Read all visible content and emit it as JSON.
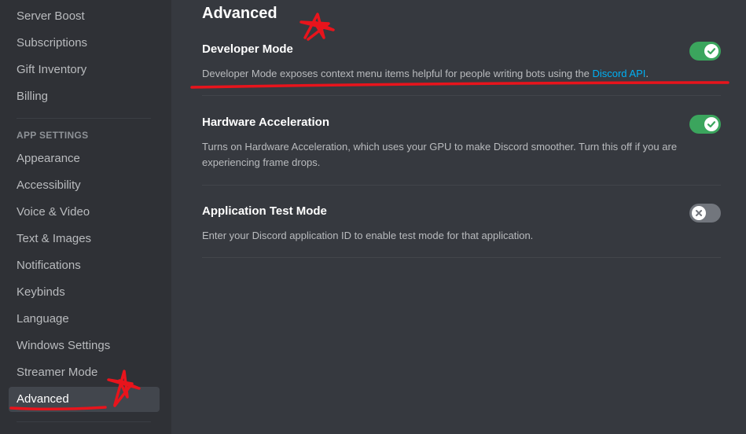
{
  "sidebar": {
    "items": [
      {
        "label": "Server Boost"
      },
      {
        "label": "Subscriptions"
      },
      {
        "label": "Gift Inventory"
      },
      {
        "label": "Billing"
      }
    ],
    "app_settings_header": "APP SETTINGS",
    "app_items": [
      {
        "label": "Appearance"
      },
      {
        "label": "Accessibility"
      },
      {
        "label": "Voice & Video"
      },
      {
        "label": "Text & Images"
      },
      {
        "label": "Notifications"
      },
      {
        "label": "Keybinds"
      },
      {
        "label": "Language"
      },
      {
        "label": "Windows Settings"
      },
      {
        "label": "Streamer Mode"
      },
      {
        "label": "Advanced",
        "selected": true
      }
    ]
  },
  "main": {
    "title": "Advanced",
    "settings": [
      {
        "title": "Developer Mode",
        "description_prefix": "Developer Mode exposes context menu items helpful for people writing bots using the ",
        "link_text": "Discord API",
        "description_suffix": ".",
        "enabled": true
      },
      {
        "title": "Hardware Acceleration",
        "description": "Turns on Hardware Acceleration, which uses your GPU to make Discord smoother. Turn this off if you are experiencing frame drops.",
        "enabled": true
      },
      {
        "title": "Application Test Mode",
        "description": "Enter your Discord application ID to enable test mode for that application.",
        "enabled": false
      }
    ]
  },
  "colors": {
    "toggle_on": "#3ba55d",
    "toggle_off": "#72767d",
    "link": "#00b0f4",
    "annotation": "#e8141c"
  },
  "icons": [
    "check-icon",
    "close-icon",
    "star-annotation",
    "underline-annotation"
  ]
}
